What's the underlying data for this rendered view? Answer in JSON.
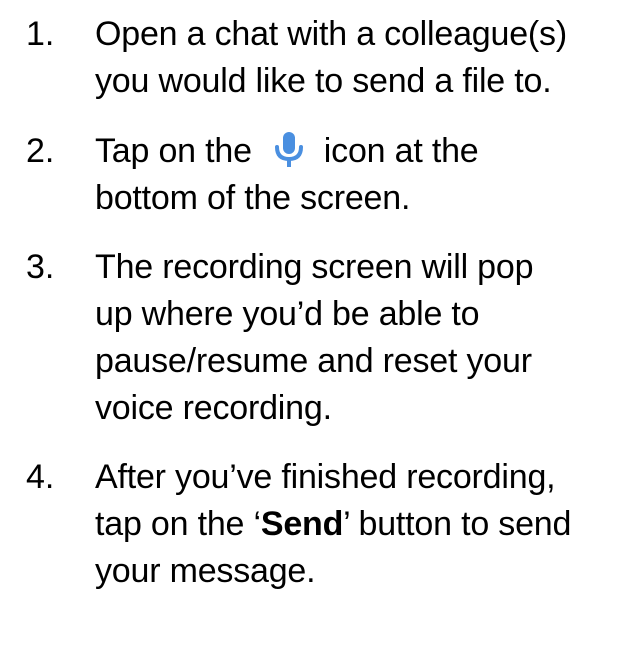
{
  "instructions": {
    "steps": [
      {
        "number": "1.",
        "lines": [
          "Open a chat with a colleague(s)",
          "you would like to send a file to."
        ]
      },
      {
        "number": "2.",
        "before_icon": "Tap on the",
        "icon": "microphone-icon",
        "after_icon": "icon at the",
        "line2": "bottom of the screen."
      },
      {
        "number": "3.",
        "lines": [
          "The recording screen will pop",
          "up where you’d be able to",
          "pause/resume and reset your",
          "voice recording."
        ]
      },
      {
        "number": "4.",
        "line1": "After you’ve finished recording,",
        "line2_before": "tap on the ‘",
        "line2_bold": "Send",
        "line2_after": "’ button to send",
        "line3": "your message."
      }
    ]
  },
  "colors": {
    "text": "#000000",
    "icon": "#4a8fe0"
  }
}
